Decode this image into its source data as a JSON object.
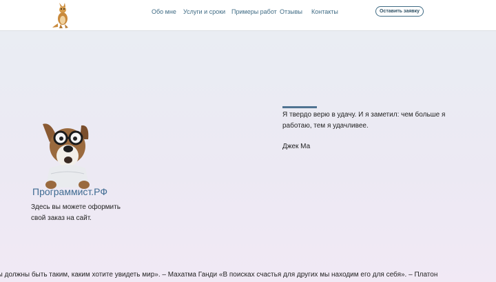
{
  "header": {
    "nav": [
      {
        "label": "Обо мне"
      },
      {
        "label": "Услуги и сроки"
      },
      {
        "label": "Примеры работ"
      },
      {
        "label": "Отзывы"
      },
      {
        "label": "Контакты"
      }
    ],
    "cta_label": "Оставить заявку",
    "logo_icon": "kangaroo-logo-icon"
  },
  "hero": {
    "mascot_icon": "dog-with-glasses-icon",
    "brand": "Программист.РФ",
    "description": "Здесь вы можете оформить свой заказ на сайт."
  },
  "quote": {
    "text": "Я твердо верю в удачу. И я заметил: чем больше я работаю, тем я удачливее.",
    "author": "Джек Ма"
  },
  "ticker": {
    "text": "Вы должны быть таким, каким хотите увидеть мир». – Махатма Ганди «В поисках счастья для других мы находим его для себя». – Платон"
  },
  "colors": {
    "accent": "#3f6b84",
    "quote_bar": "#4f7391"
  }
}
